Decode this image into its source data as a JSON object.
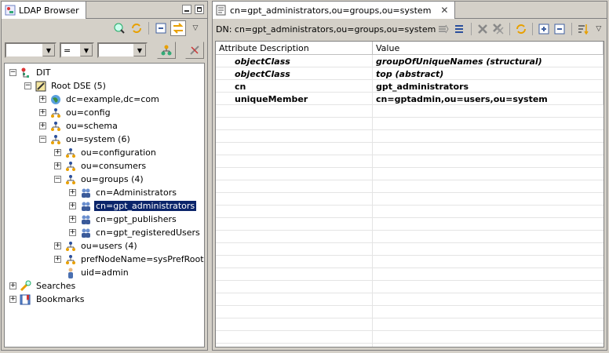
{
  "left_panel": {
    "tab_title": "LDAP Browser",
    "filter": {
      "attribute_value": "",
      "operator_value": "=",
      "value_value": ""
    },
    "tree": {
      "dit": "DIT",
      "root_dse": "Root DSE (5)",
      "example": "dc=example,dc=com",
      "config": "ou=config",
      "schema": "ou=schema",
      "system": "ou=system (6)",
      "configuration": "ou=configuration",
      "consumers": "ou=consumers",
      "groups": "ou=groups (4)",
      "administrators": "cn=Administrators",
      "gpt_administrators": "cn=gpt_administrators",
      "gpt_publishers": "cn=gpt_publishers",
      "gpt_registeredusers": "cn=gpt_registeredUsers",
      "users": "ou=users (4)",
      "prefnode": "prefNodeName=sysPrefRoot",
      "admin": "uid=admin",
      "searches": "Searches",
      "bookmarks": "Bookmarks"
    }
  },
  "editor": {
    "tab_title": "cn=gpt_administrators,ou=groups,ou=system",
    "dn_label": "DN: cn=gpt_administrators,ou=groups,ou=system",
    "columns": [
      "Attribute Description",
      "Value"
    ],
    "rows": [
      {
        "attribute": "objectClass",
        "value": "groupOfUniqueNames (structural)"
      },
      {
        "attribute": "objectClass",
        "value": "top (abstract)"
      },
      {
        "attribute": "cn",
        "value": "gpt_administrators"
      },
      {
        "attribute": "uniqueMember",
        "value": "cn=gptadmin,ou=users,ou=system"
      }
    ]
  },
  "colors": {
    "selection": "#0a246a",
    "chrome": "#d4d0c8"
  }
}
